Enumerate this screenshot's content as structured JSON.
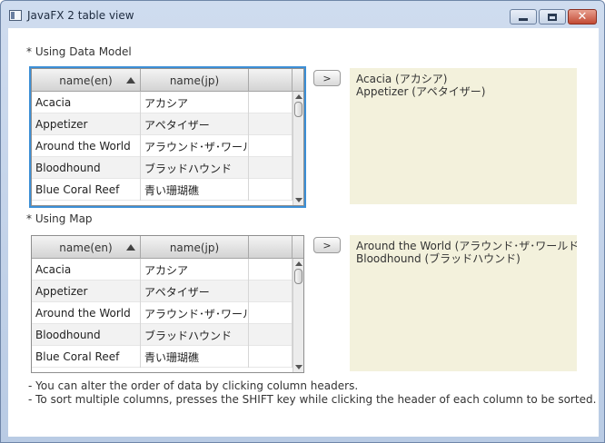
{
  "window": {
    "title": "JavaFX 2 table view",
    "buttons": {
      "minimize": "minimize",
      "maximize": "maximize",
      "close": "✕"
    }
  },
  "section1": {
    "label": "* Using Data Model",
    "table": {
      "columns": [
        "name(en)",
        "name(jp)",
        ""
      ],
      "sorted_column": "name(en)",
      "sort_direction": "ascending",
      "rows": [
        [
          "Acacia",
          "アカシア"
        ],
        [
          "Appetizer",
          "アペタイザー"
        ],
        [
          "Around the World",
          "アラウンド･ザ･ワールド"
        ],
        [
          "Bloodhound",
          "ブラッドハウンド"
        ],
        [
          "Blue Coral Reef",
          "青い珊瑚礁"
        ]
      ]
    },
    "button_label": ">",
    "output_lines": [
      "Acacia (アカシア)",
      "Appetizer (アペタイザー)"
    ]
  },
  "section2": {
    "label": "* Using Map",
    "table": {
      "columns": [
        "name(en)",
        "name(jp)",
        ""
      ],
      "sorted_column": "name(en)",
      "sort_direction": "ascending",
      "rows": [
        [
          "Acacia",
          "アカシア"
        ],
        [
          "Appetizer",
          "アペタイザー"
        ],
        [
          "Around the World",
          "アラウンド･ザ･ワールド"
        ],
        [
          "Bloodhound",
          "ブラッドハウンド"
        ],
        [
          "Blue Coral Reef",
          "青い珊瑚礁"
        ]
      ]
    },
    "button_label": ">",
    "output_lines": [
      "Around the World (アラウンド･ザ･ワールド)",
      "Bloodhound (ブラッドハウンド)"
    ]
  },
  "notes": [
    "- You can alter the order of data by clicking column headers.",
    "- To sort multiple columns, presses the SHIFT key while clicking the header of each column to be sorted."
  ],
  "colors": {
    "focus_ring": "#3c8fd6",
    "output_background": "#f3f1dc"
  }
}
